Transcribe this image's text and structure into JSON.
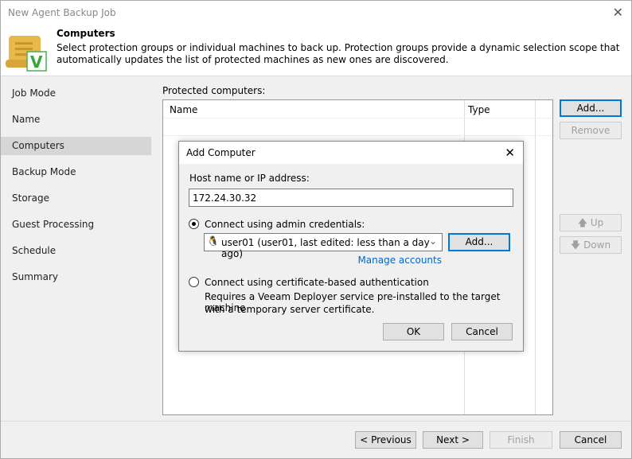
{
  "window": {
    "title": "New Agent Backup Job",
    "close": "✕"
  },
  "header": {
    "title": "Computers",
    "description": "Select protection groups or individual machines to back up. Protection groups provide a dynamic selection scope that automatically updates the list of protected machines as new ones are discovered."
  },
  "sidebar": {
    "items": [
      {
        "label": "Job Mode"
      },
      {
        "label": "Name"
      },
      {
        "label": "Computers"
      },
      {
        "label": "Backup Mode"
      },
      {
        "label": "Storage"
      },
      {
        "label": "Guest Processing"
      },
      {
        "label": "Schedule"
      },
      {
        "label": "Summary"
      }
    ]
  },
  "main": {
    "list_label": "Protected computers:",
    "columns": [
      "Name",
      "Type"
    ],
    "add": "Add...",
    "remove": "Remove",
    "up": "Up",
    "down": "Down"
  },
  "dialog": {
    "title": "Add Computer",
    "close": "✕",
    "host_label": "Host name or IP address:",
    "host_value": "172.24.30.32",
    "option1": "Connect using admin credentials:",
    "credential": "user01 (user01, last edited: less than a day ago)",
    "add": "Add...",
    "manage": "Manage accounts",
    "option2": "Connect using certificate-based authentication",
    "option2_desc1": "Requires a Veeam Deployer service pre-installed to the target machine",
    "option2_desc2": "with a temporary server certificate.",
    "ok": "OK",
    "cancel": "Cancel"
  },
  "footer": {
    "previous": "< Previous",
    "next": "Next >",
    "finish": "Finish",
    "cancel": "Cancel"
  }
}
